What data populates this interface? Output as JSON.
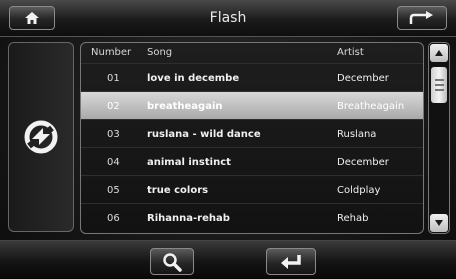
{
  "header": {
    "title": "Flash"
  },
  "list": {
    "columns": {
      "number": "Number",
      "song": "Song",
      "artist": "Artist"
    },
    "rows": [
      {
        "number": "01",
        "song": "love in decembe",
        "artist": "December"
      },
      {
        "number": "02",
        "song": "breatheagain",
        "artist": "Breatheagain"
      },
      {
        "number": "03",
        "song": "ruslana - wild dance",
        "artist": "Ruslana"
      },
      {
        "number": "04",
        "song": "animal instinct",
        "artist": "December"
      },
      {
        "number": "05",
        "song": "true colors",
        "artist": "Coldplay"
      },
      {
        "number": "06",
        "song": "Rihanna-rehab",
        "artist": "Rehab"
      }
    ],
    "selected_index": 1
  },
  "icons": {
    "home": "home-icon",
    "back": "back-arrow-icon",
    "mode": "shuffle-icon",
    "search": "search-icon",
    "enter": "enter-icon"
  },
  "colors": {
    "selected_row": "#c4c4c4",
    "background": "#141414"
  }
}
